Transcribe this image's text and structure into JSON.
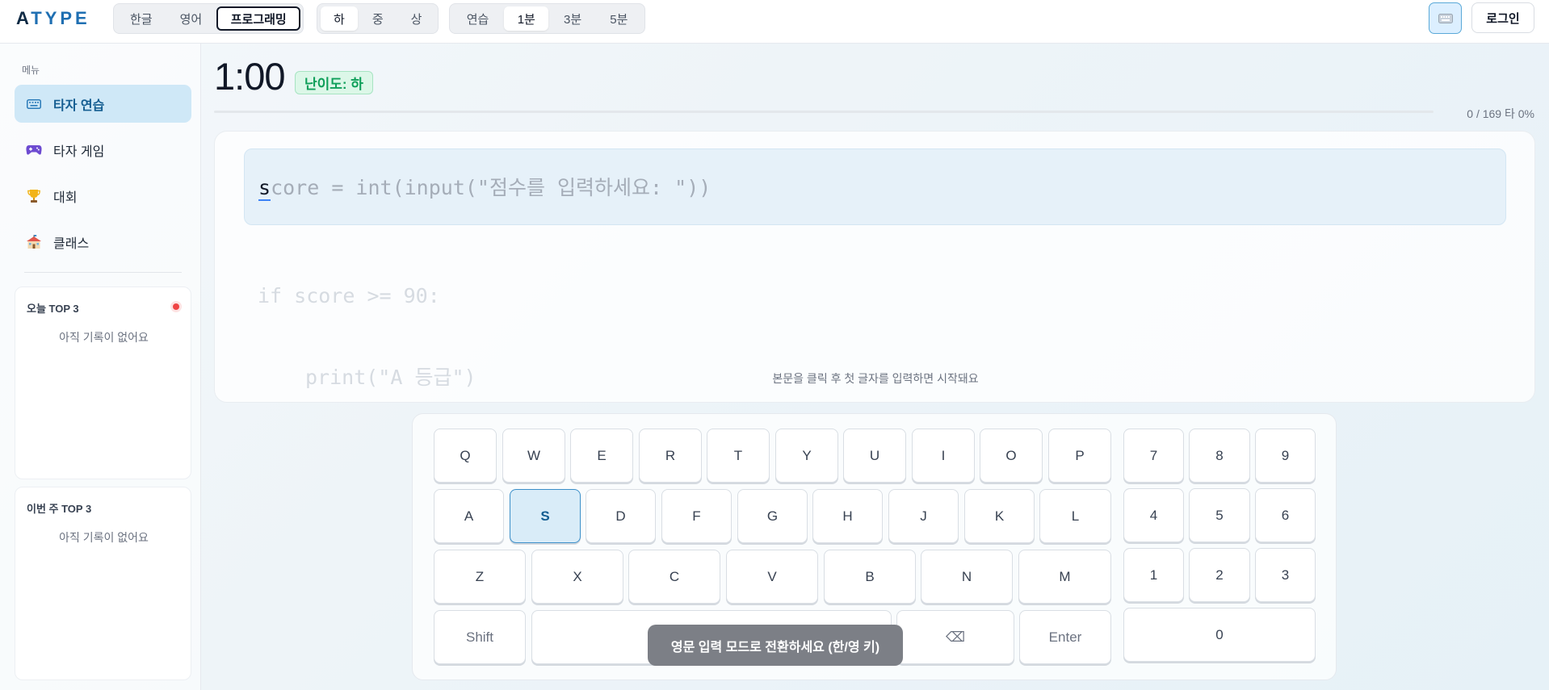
{
  "brand": {
    "logo": "ATYPE"
  },
  "language_tabs": [
    {
      "label": "한글",
      "state": "normal"
    },
    {
      "label": "영어",
      "state": "normal"
    },
    {
      "label": "프로그래밍",
      "state": "selected"
    }
  ],
  "difficulty_tabs": [
    {
      "label": "하",
      "state": "selected"
    },
    {
      "label": "중",
      "state": "normal"
    },
    {
      "label": "상",
      "state": "normal"
    }
  ],
  "duration_tabs": [
    {
      "label": "연습",
      "state": "normal"
    },
    {
      "label": "1분",
      "state": "selected"
    },
    {
      "label": "3분",
      "state": "normal"
    },
    {
      "label": "5분",
      "state": "normal"
    }
  ],
  "header": {
    "keyboard_icon": "keyboard-icon",
    "login_label": "로그인"
  },
  "sidebar": {
    "menu_heading": "메뉴",
    "items": [
      {
        "label": "타자 연습",
        "icon": "keyboard-icon",
        "active": true
      },
      {
        "label": "타자 게임",
        "icon": "gamepad-icon",
        "active": false
      },
      {
        "label": "대회",
        "icon": "trophy-icon",
        "active": false
      },
      {
        "label": "클래스",
        "icon": "school-icon",
        "active": false
      }
    ],
    "today_top3": {
      "title": "오늘 TOP 3",
      "empty": "아직 기록이 없어요"
    },
    "week_top3": {
      "title": "이번 주 TOP 3",
      "empty": "아직 기록이 없어요"
    }
  },
  "main": {
    "timer": "1:00",
    "level_badge": "난이도: 하",
    "progress_fraction": 0,
    "stats": "0 / 169 타 0%",
    "current_line_first": "s",
    "current_line_rest": "core = int(input(\"점수를 입력하세요: \"))",
    "next_lines": [
      "if score >= 90:",
      "print(\"A 등급\")"
    ],
    "hint": "본문을 클릭 후 첫 글자를 입력하면 시작돼요"
  },
  "keyboard": {
    "row1": [
      "Q",
      "W",
      "E",
      "R",
      "T",
      "Y",
      "U",
      "I",
      "O",
      "P"
    ],
    "row2": [
      "A",
      "S",
      "D",
      "F",
      "G",
      "H",
      "J",
      "K",
      "L"
    ],
    "row3": [
      "Z",
      "X",
      "C",
      "V",
      "B",
      "N",
      "M"
    ],
    "row4": {
      "shift": "Shift",
      "backspace": "⌫",
      "enter": "Enter"
    },
    "numpad": [
      [
        "7",
        "8",
        "9"
      ],
      [
        "4",
        "5",
        "6"
      ],
      [
        "1",
        "2",
        "3"
      ],
      [
        "0"
      ]
    ],
    "highlighted_key": "S"
  },
  "toast": "영문 입력 모드로 전환하세요 (한/영 키)",
  "colors": {
    "accent": "#3b8fc9",
    "active_nav_bg": "#cfe8f7",
    "badge_green": "#0f9f5a"
  }
}
